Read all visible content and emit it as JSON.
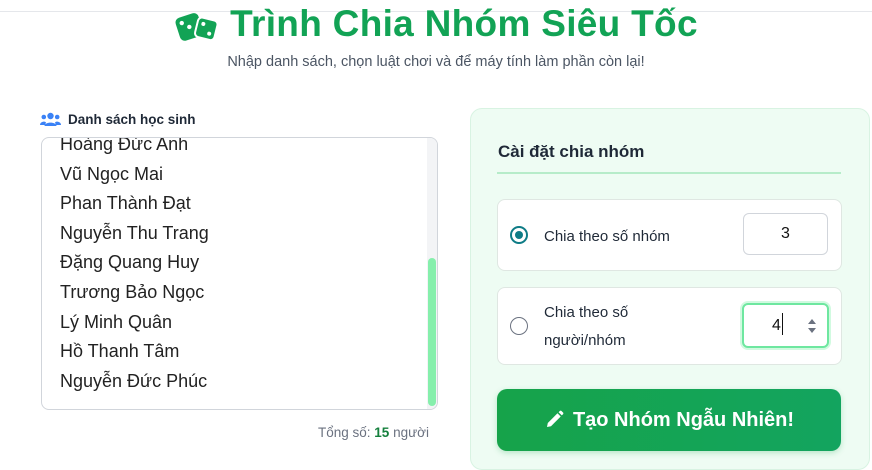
{
  "header": {
    "title": "Trình Chia Nhóm Siêu Tốc",
    "subtitle": "Nhập danh sách, chọn luật chơi và để máy tính làm phần còn lại!",
    "icon": "dice-icon"
  },
  "student_list": {
    "label": "Danh sách học sinh",
    "icon": "users-icon",
    "names": [
      "Hoàng Đức Anh",
      "Vũ Ngọc Mai",
      "Phan Thành Đạt",
      "Nguyễn Thu Trang",
      "Đặng Quang Huy",
      "Trương Bảo Ngọc",
      "Lý Minh Quân",
      "Hồ Thanh Tâm",
      "Nguyễn Đức Phúc"
    ],
    "total_prefix": "Tổng số:",
    "total_count": "15",
    "total_suffix": "người"
  },
  "settings": {
    "title": "Cài đặt chia nhóm",
    "option_groups": {
      "label": "Chia theo số nhóm",
      "value": "3",
      "selected": true
    },
    "option_people": {
      "label_line1": "Chia theo số",
      "label_line2": "người/nhóm",
      "value": "4",
      "selected": false
    },
    "generate_button": "Tạo Nhóm Ngẫu Nhiên!"
  },
  "colors": {
    "accent": "#12a355",
    "radio": "#0e7c86",
    "button": "#16a34a"
  }
}
